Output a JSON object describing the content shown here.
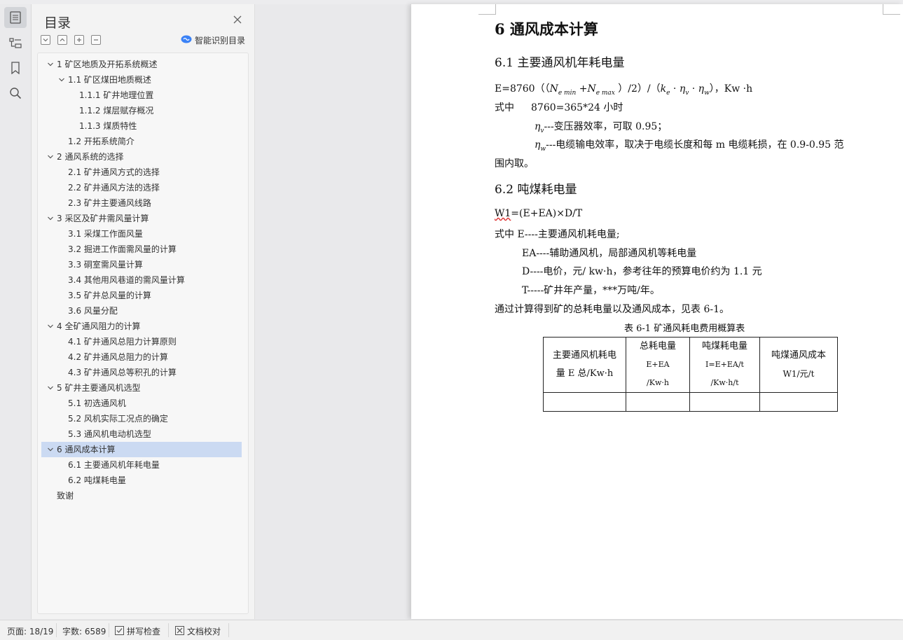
{
  "nav": {
    "title": "目录",
    "smart_label": "智能识别目录",
    "items": [
      {
        "label": "1 矿区地质及开拓系统概述",
        "level": 1,
        "expandable": true,
        "selected": false
      },
      {
        "label": "1.1 矿区煤田地质概述",
        "level": 2,
        "expandable": true,
        "selected": false
      },
      {
        "label": "1.1.1 矿井地理位置",
        "level": 3,
        "expandable": false,
        "selected": false
      },
      {
        "label": "1.1.2 煤层赋存概况",
        "level": 3,
        "expandable": false,
        "selected": false
      },
      {
        "label": "1.1.3 煤质特性",
        "level": 3,
        "expandable": false,
        "selected": false
      },
      {
        "label": "1.2 开拓系统简介",
        "level": 2,
        "expandable": false,
        "selected": false
      },
      {
        "label": "2 通风系统的选择",
        "level": 1,
        "expandable": true,
        "selected": false
      },
      {
        "label": "2.1 矿井通风方式的选择",
        "level": 2,
        "expandable": false,
        "selected": false
      },
      {
        "label": "2.2 矿井通风方法的选择",
        "level": 2,
        "expandable": false,
        "selected": false
      },
      {
        "label": "2.3 矿井主要通风线路",
        "level": 2,
        "expandable": false,
        "selected": false
      },
      {
        "label": "3 采区及矿井需风量计算",
        "level": 1,
        "expandable": true,
        "selected": false
      },
      {
        "label": "3.1 采煤工作面风量",
        "level": 2,
        "expandable": false,
        "selected": false
      },
      {
        "label": "3.2 掘进工作面需风量的计算",
        "level": 2,
        "expandable": false,
        "selected": false
      },
      {
        "label": "3.3 硐室需风量计算",
        "level": 2,
        "expandable": false,
        "selected": false
      },
      {
        "label": "3.4 其他用风巷道的需风量计算",
        "level": 2,
        "expandable": false,
        "selected": false
      },
      {
        "label": "3.5 矿井总风量的计算",
        "level": 2,
        "expandable": false,
        "selected": false
      },
      {
        "label": "3.6 风量分配",
        "level": 2,
        "expandable": false,
        "selected": false
      },
      {
        "label": "4 全矿通风阻力的计算",
        "level": 1,
        "expandable": true,
        "selected": false
      },
      {
        "label": "4.1 矿井通风总阻力计算原则",
        "level": 2,
        "expandable": false,
        "selected": false
      },
      {
        "label": "4.2 矿井通风总阻力的计算",
        "level": 2,
        "expandable": false,
        "selected": false
      },
      {
        "label": "4.3 矿井通风总等积孔的计算",
        "level": 2,
        "expandable": false,
        "selected": false
      },
      {
        "label": "5 矿井主要通风机选型",
        "level": 1,
        "expandable": true,
        "selected": false
      },
      {
        "label": "5.1 初选通风机",
        "level": 2,
        "expandable": false,
        "selected": false
      },
      {
        "label": "5.2 风机实际工况点的确定",
        "level": 2,
        "expandable": false,
        "selected": false
      },
      {
        "label": "5.3 通风机电动机选型",
        "level": 2,
        "expandable": false,
        "selected": false
      },
      {
        "label": "6 通风成本计算",
        "level": 1,
        "expandable": true,
        "selected": true
      },
      {
        "label": "6.1 主要通风机年耗电量",
        "level": 2,
        "expandable": false,
        "selected": false
      },
      {
        "label": "6.2 吨煤耗电量",
        "level": 2,
        "expandable": false,
        "selected": false
      },
      {
        "label": "致谢",
        "level": 1,
        "expandable": false,
        "selected": false
      }
    ]
  },
  "doc": {
    "h1": "6 通风成本计算",
    "h2_1": "6.1 主要通风机年耗电量",
    "formula1": {
      "a": "E=8760（（",
      "n": "N",
      "sub_min": "e min",
      "plus": " +",
      "sub_max": "e max",
      "b": " ）/2）/（",
      "k": "k",
      "sub_e": "e",
      "dot1": " · ",
      "eta": "η",
      "sub_v": "v",
      "dot2": " · ",
      "sub_w": "w",
      "c": "），Kw  ·h"
    },
    "line_shizhong1_a": "式中",
    "line_shizhong1_b": "8760=365*24 小时",
    "line_etav": "---变压器效率，可取 0.95；",
    "line_etaw": "---电缆输电效率，取决于电缆长度和每 m 电缆耗损，在 0.9-0.95 范",
    "line_etaw2": "围内取。",
    "h2_2": "6.2 吨煤耗电量",
    "w1_a": "W1",
    "w1_b": "=(E+EA)×D/T",
    "def_E": "式中 E----主要通风机耗电量;",
    "def_EA": "EA----辅助通风机，局部通风机等耗电量",
    "def_D": "D----电价，元/ kw·h，参考往年的预算电价约为 1.1 元",
    "def_T": "T-----矿井年产量，***万吨/年。",
    "summary": "通过计算得到矿的总耗电量以及通风成本，见表 6-1。",
    "table_caption": "表 6-1 矿通风耗电费用概算表",
    "table": {
      "c1_l1": "主要通风机耗电",
      "c1_l2": "量 E 总/Kw·h",
      "c2_l1": "总耗电量",
      "c2_l2": "E+EA",
      "c2_l3": "/Kw·h",
      "c3_l1": "吨煤耗电量",
      "c3_l2": "I=E+EA/t",
      "c3_l3": "/Kw·h/t",
      "c4_l1": "吨煤通风成本",
      "c4_l2": "W1/元/t"
    }
  },
  "status": {
    "page": "页面: 18/19",
    "words": "字数: 6589",
    "spell": "拼写检查",
    "proof": "文档校对"
  },
  "colors": {
    "selected_row": "#cbdaf2",
    "accent": "#3b82f6"
  },
  "icons": [
    "toc-icon",
    "outline-icon",
    "bookmark-icon",
    "search-icon",
    "close-icon",
    "collapse-all-icon",
    "expand-all-icon",
    "add-icon",
    "remove-icon",
    "smart-recognize-icon",
    "chevron-down-icon",
    "checkbox-icon",
    "proofread-icon"
  ]
}
